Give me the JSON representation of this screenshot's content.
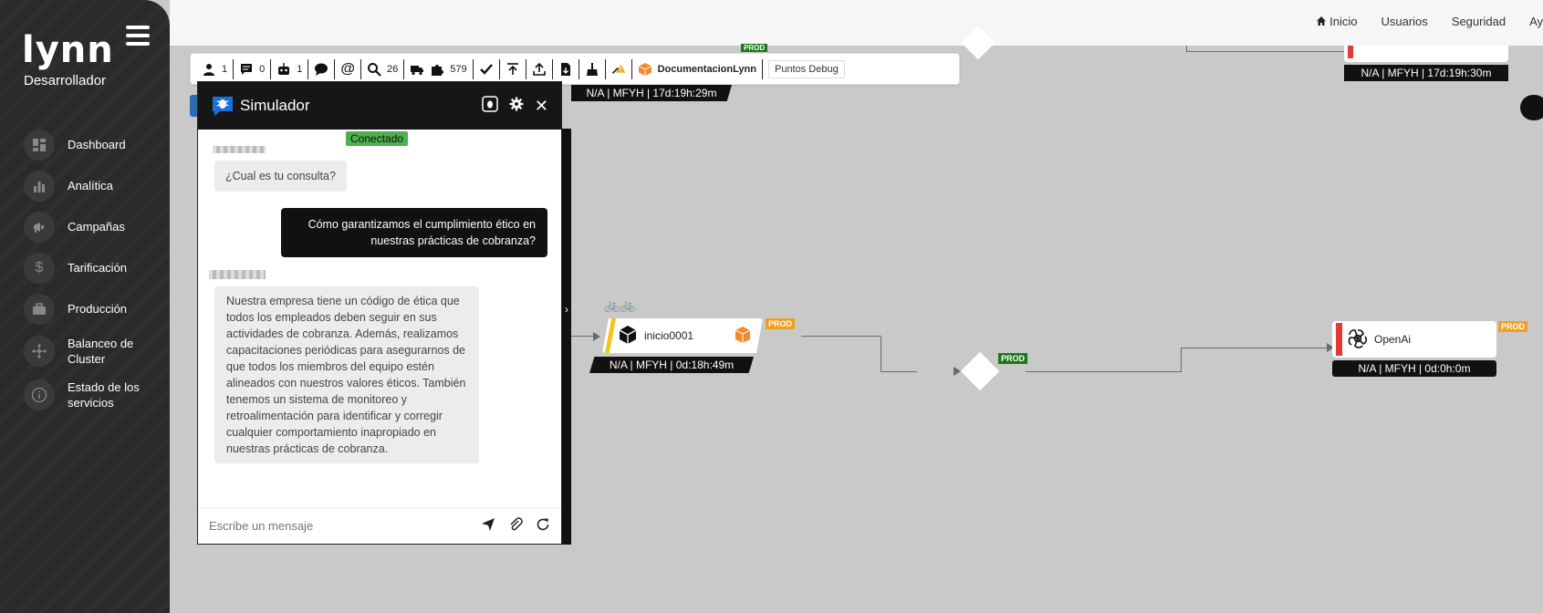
{
  "sidebar": {
    "logo": "lynn",
    "role": "Desarrollador",
    "items": [
      {
        "label": "Dashboard",
        "icon": "dashboard-icon"
      },
      {
        "label": "Analítica",
        "icon": "bar-chart-icon"
      },
      {
        "label": "Campañas",
        "icon": "megaphone-icon"
      },
      {
        "label": "Tarificación",
        "icon": "dollar-icon"
      },
      {
        "label": "Producción",
        "icon": "briefcase-icon"
      },
      {
        "label": "Balanceo de Cluster",
        "icon": "cluster-icon"
      },
      {
        "label": "Estado de los servicios",
        "icon": "info-icon"
      }
    ]
  },
  "topnav": {
    "inicio": "Inicio",
    "usuarios": "Usuarios",
    "seguridad": "Seguridad",
    "ayuda": "Ay"
  },
  "toolbar": {
    "users_count": "1",
    "messages_count": "0",
    "bots_count": "1",
    "search_count": "26",
    "plugins_count": "579",
    "project_name": "DocumentacionLynn",
    "debug_label": "Puntos Debug"
  },
  "simulator": {
    "title": "Simulador",
    "status": "Conectado",
    "messages": [
      {
        "from": "bot",
        "text": "¿Cual es tu consulta?"
      },
      {
        "from": "user",
        "text": "Cómo garantizamos el cumplimiento ético en nuestras prácticas de cobranza?"
      },
      {
        "from": "bot",
        "text": " Nuestra empresa tiene un código de ética que todos los empleados deben seguir en sus actividades de cobranza. Además, realizamos capacitaciones periódicas para asegurarnos de que todos los miembros del equipo estén alineados con nuestros valores éticos. También tenemos un sistema de monitoreo y retroalimentación para identificar y corregir cualquier comportamiento inapropiado en nuestras prácticas de cobranza."
      }
    ],
    "input_placeholder": "Escribe un mensaje"
  },
  "flow": {
    "top_status_left": "N/A | MFYH | 17d:19h:29m",
    "top_status_right": "N/A | MFYH | 17d:19h:30m",
    "top_tag": "PROD",
    "start_node": {
      "label": "inicio0001",
      "tag": "PROD",
      "status": "N/A | MFYH | 0d:18h:49m"
    },
    "diamond_tag": "PROD",
    "openai_node": {
      "label": "OpenAi",
      "tag": "PROD",
      "status": "N/A | MFYH | 0d:0h:0m"
    }
  },
  "colors": {
    "sidebar_bg": "#2a2a2a",
    "canvas_bg": "#c9c9c9",
    "connected_green": "#4caf50",
    "prod_orange": "#f0a020",
    "prod_green": "#1a7a1a",
    "node_accent_red": "#e53935",
    "node_accent_yellow": "#f5c518"
  }
}
